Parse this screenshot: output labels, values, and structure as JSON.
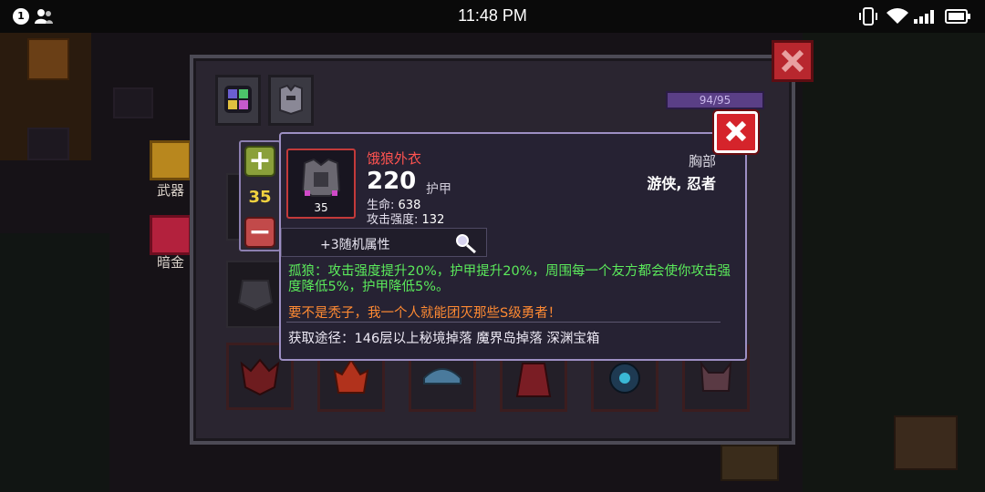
{
  "status_bar": {
    "notification_count": "1",
    "time": "11:48 PM",
    "icons": [
      "user-icon",
      "vibrate-icon",
      "wifi-icon",
      "signal-icon",
      "battery-icon"
    ]
  },
  "sidebar": {
    "weapon_label": "武器",
    "gold_label": "暗金"
  },
  "inventory": {
    "capacity": "94/95",
    "tabs": [
      "gems-tab-icon",
      "armor-tab-icon"
    ]
  },
  "counter": {
    "value": "35"
  },
  "item": {
    "name": "饿狼外衣",
    "level": "35",
    "armor_value": "220",
    "armor_label": "护甲",
    "slot": "胸部",
    "classes": "游侠, 忍者",
    "stats": [
      {
        "label": "生命:",
        "value": "638"
      },
      {
        "label": "攻击强度:",
        "value": "132"
      }
    ],
    "random_attr": "+3随机属性",
    "set_effect": "孤狼：攻击强度提升20%，护甲提升20%，周围每一个友方都会使你攻击强度降低5%，护甲降低5%。",
    "quote": "要不是秃子，我一个人就能团灭那些S级勇者！",
    "source": "获取途径：146层以上秘境掉落 魔界岛掉落 深渊宝箱"
  },
  "colors": {
    "item_name": "#ff5350",
    "set_effect": "#5bea5b",
    "quote": "#ff8a33",
    "close_button": "#d5242b",
    "count": "#f1d23f",
    "capacity_bar": "#5a3f86"
  }
}
